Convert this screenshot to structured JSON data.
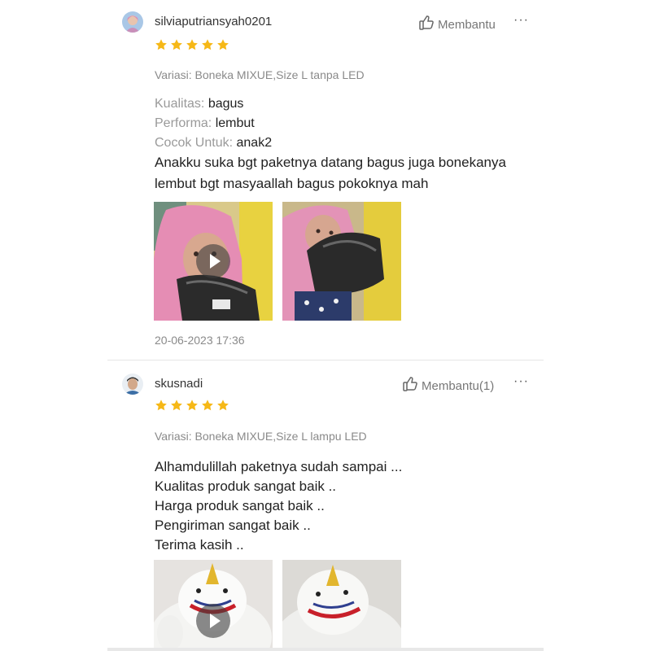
{
  "reviews": [
    {
      "username": "silviaputriansyah0201",
      "helpful_label": "Membantu",
      "more": "···",
      "rating": 5,
      "variation": "Variasi: Boneka MIXUE,Size L tanpa LED",
      "attributes": [
        {
          "key": "Kualitas:",
          "value": "bagus"
        },
        {
          "key": "Performa:",
          "value": "lembut"
        },
        {
          "key": "Cocok Untuk:",
          "value": "anak2"
        }
      ],
      "body_lines": [
        "Anakku suka bgt paketnya datang bagus juga bonekanya",
        "lembut bgt masyaallah bagus pokoknya mah"
      ],
      "media": [
        {
          "kind": "video",
          "icon": "play-icon"
        },
        {
          "kind": "photo"
        }
      ],
      "timestamp": "20-06-2023 17:36"
    },
    {
      "username": "skusnadi",
      "helpful_label": "Membantu(1)",
      "more": "···",
      "rating": 5,
      "variation": "Variasi: Boneka MIXUE,Size L lampu LED",
      "body_lines": [
        "Alhamdulillah paketnya sudah sampai ...",
        "Kualitas produk sangat baik ..",
        "Harga produk sangat baik ..",
        "Pengiriman sangat baik ..",
        "Terima kasih .."
      ],
      "media": [
        {
          "kind": "video",
          "icon": "play-icon"
        },
        {
          "kind": "photo"
        }
      ]
    }
  ],
  "colors": {
    "star": "#f6b817",
    "muted": "#8a8a8a",
    "text": "#222222"
  }
}
